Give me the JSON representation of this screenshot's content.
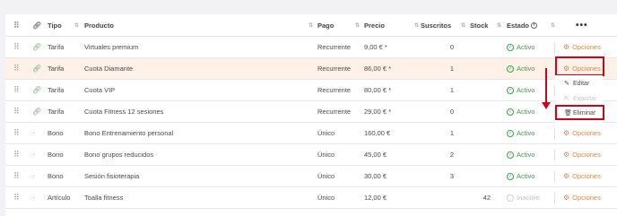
{
  "header": {
    "tipo": "Tipo",
    "producto": "Producto",
    "pago": "Pago",
    "precio": "Precio",
    "suscritos": "Suscritos",
    "stock": "Stock",
    "estado": "Estado",
    "menu": "•••"
  },
  "rows": [
    {
      "tipo": "Tarifa",
      "producto": "Virtuales premium",
      "pago": "Recurrente",
      "precio": "9,00 € *",
      "suscritos": "0",
      "stock": "",
      "estado": "Activo",
      "opciones": "Opciones",
      "link": true
    },
    {
      "tipo": "Tarifa",
      "producto": "Cuota Diamante",
      "pago": "Recurrente",
      "precio": "86,00 € *",
      "suscritos": "1",
      "stock": "",
      "estado": "Activo",
      "opciones": "Opciones",
      "link": true
    },
    {
      "tipo": "Tarifa",
      "producto": "Cuota VIP",
      "pago": "Recurrente",
      "precio": "80,00 € *",
      "suscritos": "1",
      "stock": "",
      "estado": "Activo",
      "opciones": "Opciones",
      "link": true
    },
    {
      "tipo": "Tarifa",
      "producto": "Cuota Fitness 12 sesiones",
      "pago": "Recurrente",
      "precio": "29,00 € *",
      "suscritos": "0",
      "stock": "",
      "estado": "Activo",
      "opciones": "Opciones",
      "link": true
    },
    {
      "tipo": "Bono",
      "producto": "Bono Entrenamiento personal",
      "pago": "Único",
      "precio": "160,00 €",
      "suscritos": "1",
      "stock": "",
      "estado": "Activo",
      "opciones": "Opciones",
      "link": false
    },
    {
      "tipo": "Bono",
      "producto": "Bono grupos reducidos",
      "pago": "Único",
      "precio": "45,00 €",
      "suscritos": "2",
      "stock": "",
      "estado": "Activo",
      "opciones": "Opciones",
      "link": false
    },
    {
      "tipo": "Bono",
      "producto": "Sesión fisioterapia",
      "pago": "Único",
      "precio": "30,00 €",
      "suscritos": "3",
      "stock": "",
      "estado": "Activo",
      "opciones": "Opciones",
      "link": false
    },
    {
      "tipo": "Artículo",
      "producto": "Toalla fitness",
      "pago": "Único",
      "precio": "12,00 €",
      "suscritos": "",
      "stock": "42",
      "estado": "Inactivo",
      "opciones": "Opciones",
      "link": false
    }
  ],
  "context_menu": {
    "editar": "Editar",
    "exportar": "Exportar",
    "eliminar": "Eliminar"
  },
  "colors": {
    "highlight_row": "#fdf1e8",
    "active_green": "#3aa04a",
    "options_orange": "#e08a4a",
    "annotation_red": "#d0021b"
  },
  "icons": {
    "drag": "drag-handle-icon",
    "link": "link-icon",
    "status_active": "check-circle-icon",
    "options": "gear-icon",
    "edit": "pencil-icon",
    "export": "export-icon",
    "delete": "trash-icon"
  }
}
